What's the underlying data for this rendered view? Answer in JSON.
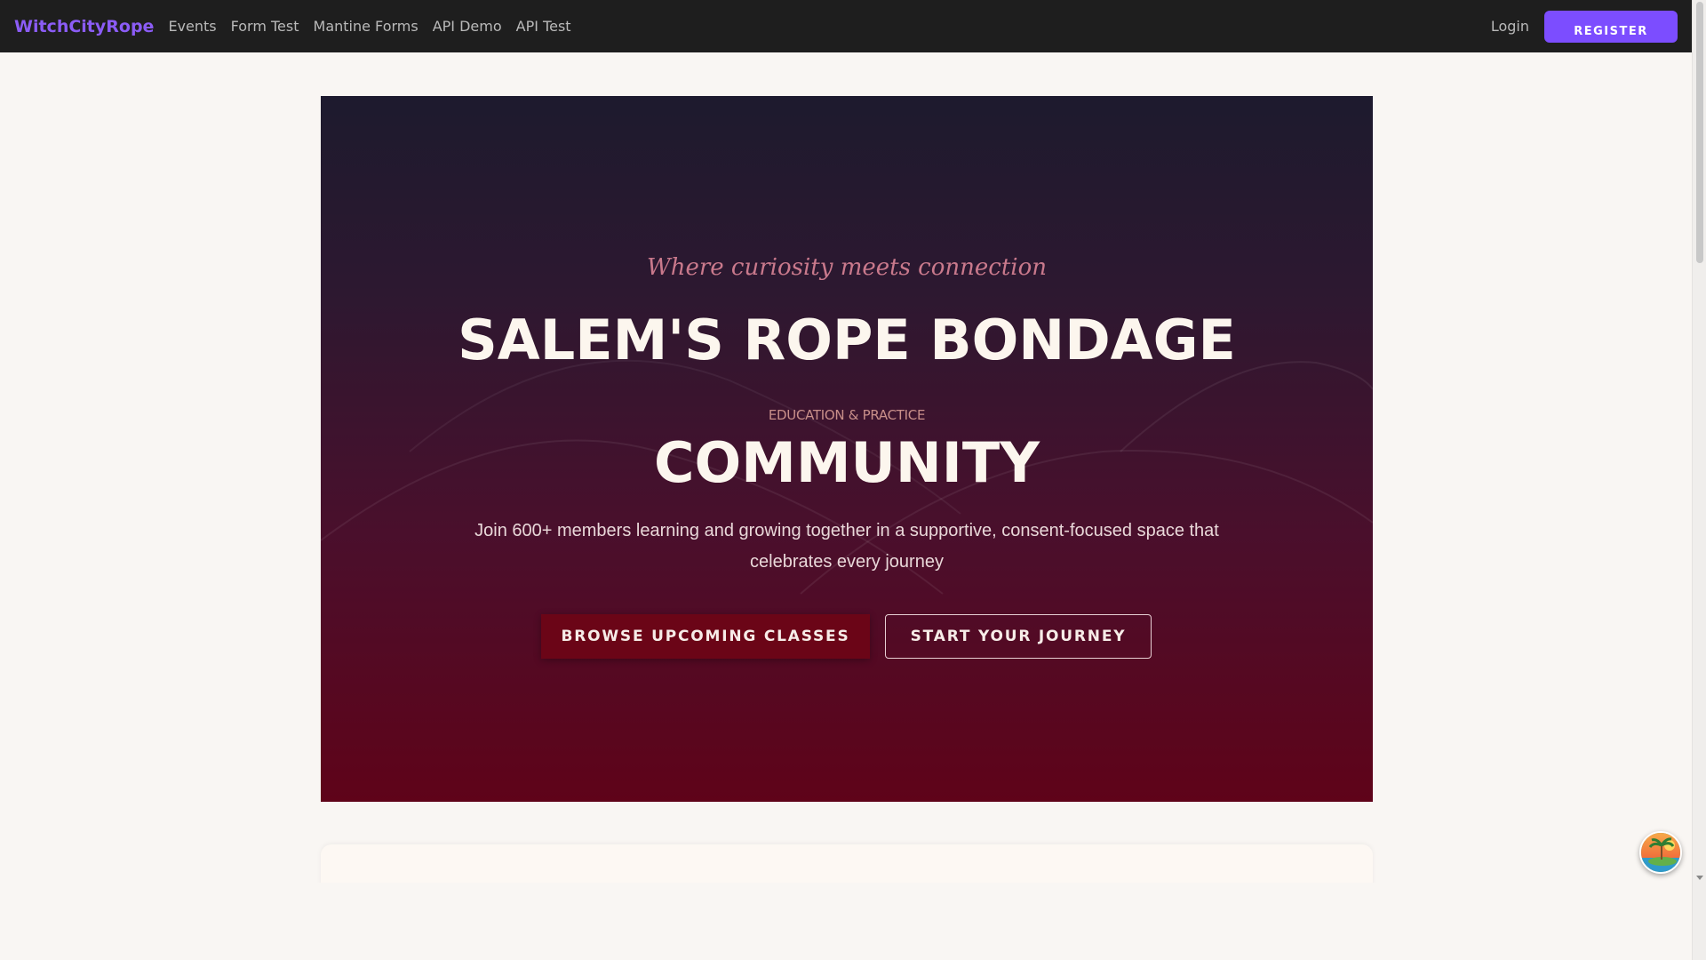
{
  "nav": {
    "brand": "WitchCityRope",
    "links": [
      "Events",
      "Form Test",
      "Mantine Forms",
      "API Demo",
      "API Test"
    ],
    "login": "Login",
    "register": "REGISTER"
  },
  "hero": {
    "tagline": "Where curiosity meets connection",
    "title": "SALEM'S ROPE BONDAGE",
    "subtitle": "EDUCATION & PRACTICE",
    "title2": "COMMUNITY",
    "description": "Join 600+ members learning and growing together in a supportive, consent-focused space that celebrates every journey",
    "primary_button": "BROWSE UPCOMING CLASSES",
    "secondary_button": "START YOUR JOURNEY"
  },
  "colors": {
    "brand": "#8b5cf6",
    "register": "#7c4dff",
    "hero_top": "#1d1a2e",
    "hero_bottom": "#5f0319",
    "primary_button": "#6b0517"
  },
  "floating_widget": {
    "icon": "island-avatar-icon"
  }
}
